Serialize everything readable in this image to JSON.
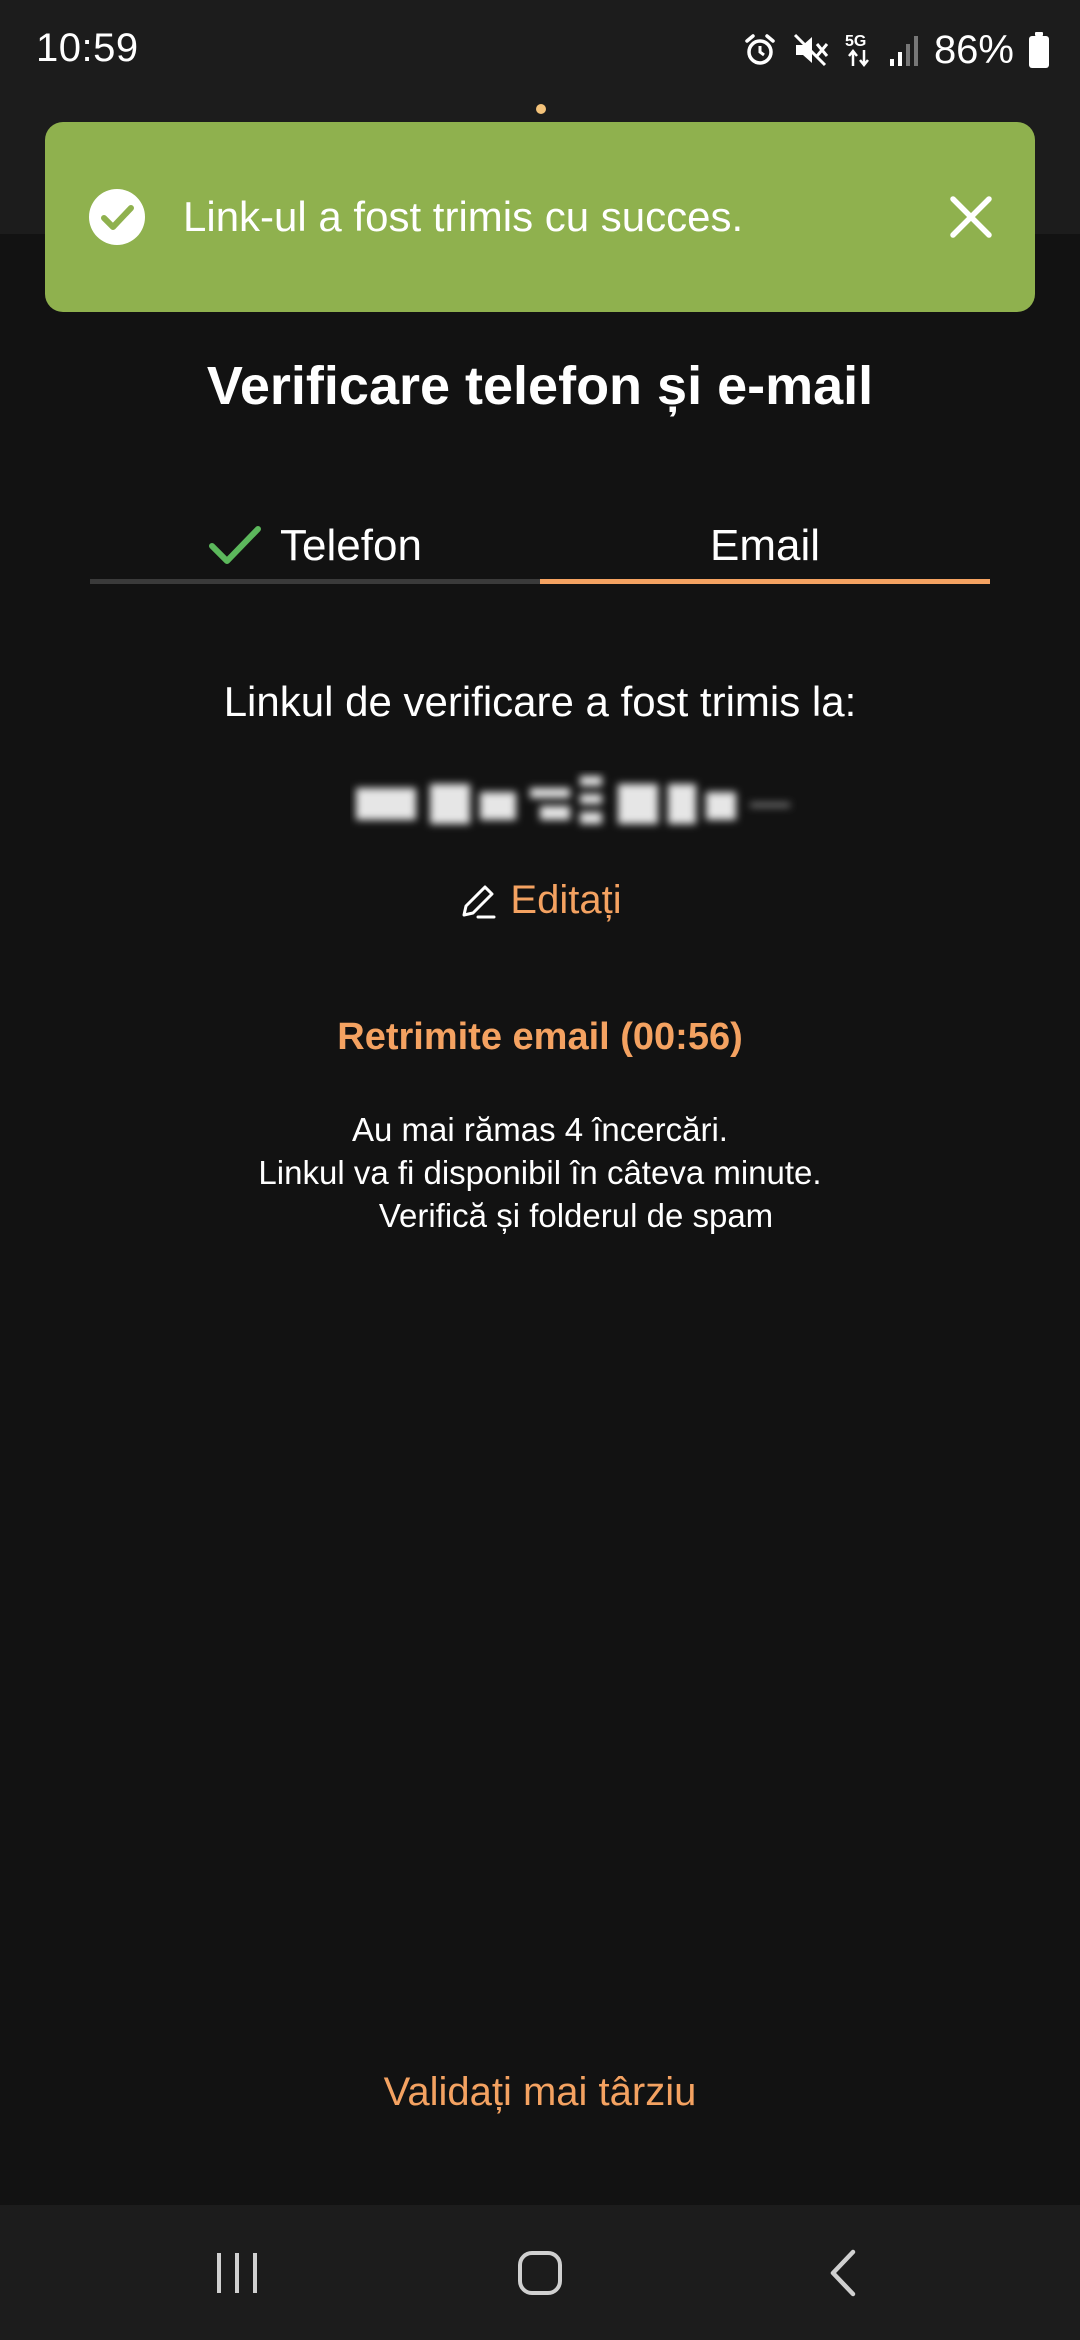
{
  "status_bar": {
    "time": "10:59",
    "battery_percent": "86%",
    "icons": [
      "alarm-icon",
      "mute-icon",
      "5g-icon",
      "signal-icon",
      "battery-icon"
    ]
  },
  "toast": {
    "message": "Link-ul a fost trimis cu succes.",
    "icon": "check-circle-icon",
    "close_icon": "close-icon",
    "background_color": "#8fb14e"
  },
  "page": {
    "title": "Verificare telefon și e-mail"
  },
  "tabs": [
    {
      "label": "Telefon",
      "completed": true,
      "active": false
    },
    {
      "label": "Email",
      "completed": false,
      "active": true
    }
  ],
  "verification": {
    "sent_to_label": "Linkul de verificare a fost trimis la:",
    "edit_label": "Editați",
    "resend_label": "Retrimite email (00:56)",
    "info_line1": "Au mai rămas 4 încercări.",
    "info_line2": "Linkul va fi disponibil în câteva minute.",
    "info_line3": "Verifică și folderul de spam"
  },
  "footer": {
    "later_label": "Validați mai târziu"
  },
  "colors": {
    "accent": "#f4a261",
    "success": "#8fb14e",
    "check_green": "#5cb85c",
    "background": "#121212"
  }
}
